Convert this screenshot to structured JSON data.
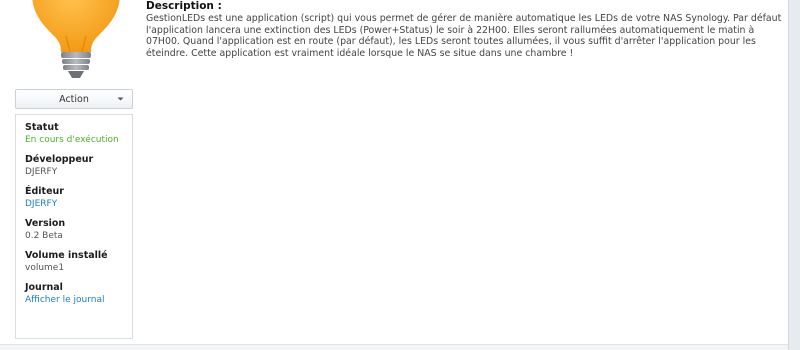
{
  "app": {
    "icon": "lightbulb-icon",
    "colors": {
      "bulb": "#f8a323",
      "base": "#9a9ea3"
    }
  },
  "action": {
    "label": "Action"
  },
  "info": [
    {
      "label": "Statut",
      "value": "En cours d'exécution",
      "style": "green"
    },
    {
      "label": "Développeur",
      "value": "DJERFY",
      "style": "plain"
    },
    {
      "label": "Éditeur",
      "value": "DJERFY",
      "style": "link"
    },
    {
      "label": "Version",
      "value": "0.2 Beta",
      "style": "plain"
    },
    {
      "label": "Volume installé",
      "value": "volume1",
      "style": "plain"
    },
    {
      "label": "Journal",
      "value": "Afficher le journal",
      "style": "link"
    }
  ],
  "description": {
    "title": "Description :",
    "text": "GestionLEDs est une application (script) qui vous permet de gérer de manière automatique les LEDs de votre NAS Synology. Par défaut l'application lancera une extinction des LEDs (Power+Status) le soir à 22H00. Elles seront rallumées automatiquement le matin à 07H00. Quand l'application est en route (par défaut), les LEDs seront toutes allumées, il vous suffit d'arrêter l'application pour les éteindre. Cette application est vraiment idéale lorsque le NAS se situe dans une chambre !"
  }
}
